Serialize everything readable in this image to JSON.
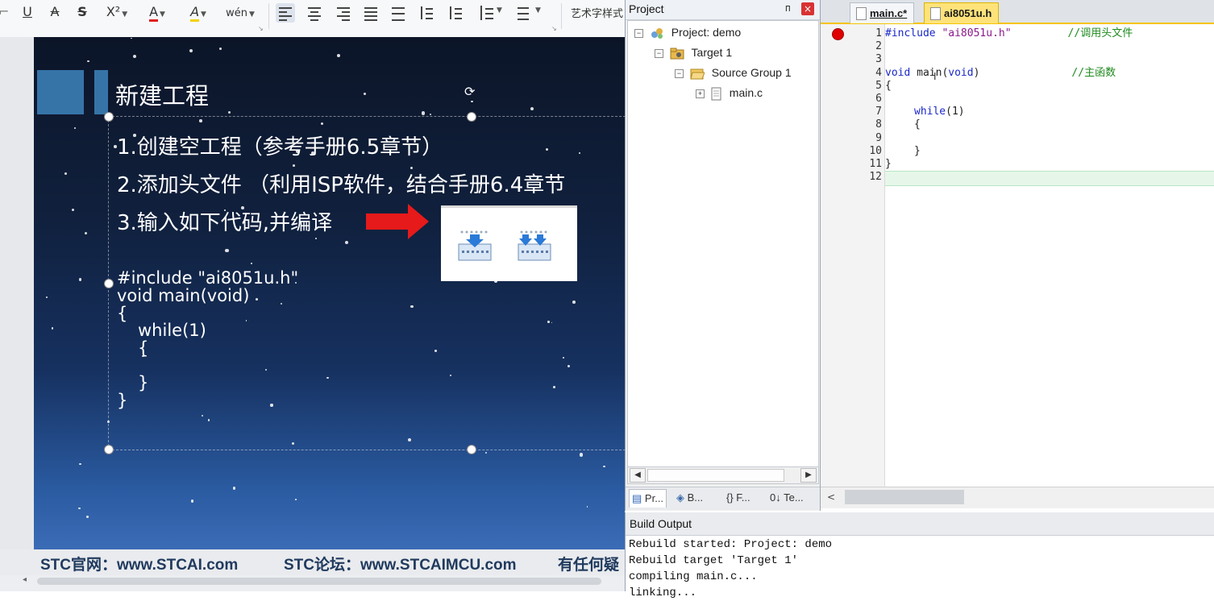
{
  "ribbon": {
    "buttons": [
      "U",
      "A",
      "S",
      "X²",
      "A",
      "A",
      "wén"
    ],
    "wordart_label": "艺术字样式"
  },
  "slide": {
    "title": "新建工程",
    "lines": [
      "1.创建空工程（参考手册6.5章节）",
      "2.添加头文件 （利用ISP软件，结合手册6.4章节",
      "3.输入如下代码,并编译"
    ],
    "code": [
      "#include \"ai8051u.h\"",
      "void main(void)",
      "{",
      "while(1)",
      "{",
      "}",
      "}"
    ]
  },
  "footer": {
    "site": "STC官网：www.STCAI.com",
    "forum": "STC论坛：www.STCAIMCU.com",
    "question": "有任何疑"
  },
  "project_panel": {
    "title": "Project",
    "pin": "ᴨ",
    "close": "×",
    "tree": [
      {
        "label": "Project: demo",
        "sign": "⊟"
      },
      {
        "label": "Target 1",
        "sign": "⊟"
      },
      {
        "label": "Source Group 1",
        "sign": "⊟"
      },
      {
        "label": "main.c",
        "sign": "⊞"
      }
    ],
    "bottom_tabs": [
      "Pr...",
      "B...",
      "{} F...",
      "0↓ Te..."
    ]
  },
  "editor": {
    "tabs": [
      "main.c*",
      "ai8051u.h"
    ],
    "line_numbers": [
      "1",
      "2",
      "3",
      "4",
      "5",
      "6",
      "7",
      "8",
      "9",
      "10",
      "11",
      "12"
    ],
    "code": {
      "l1_kw": "#include",
      "l1_str": "\"ai8051u.h\"",
      "l1_cm": "//调用头文件",
      "l4_kw1": "void",
      "l4_fn": "main(",
      "l4_kw2": "void",
      "l4_close": ")",
      "l4_cm": "//主函数",
      "l5": "{",
      "l7_kw": "while",
      "l7_rest": "(1)",
      "l8": "{",
      "l10": "}",
      "l11": "}"
    }
  },
  "build_output": {
    "title": "Build Output",
    "lines": [
      "Rebuild started: Project: demo",
      "Rebuild target 'Target 1'",
      "compiling main.c...",
      "linking..."
    ]
  },
  "colors": {
    "accent_square": "#3674a8",
    "breakpoint": "#e00000",
    "keyword": "#1a28c8",
    "comment": "#1f8a1f",
    "tab_active": "#ffe37a"
  }
}
